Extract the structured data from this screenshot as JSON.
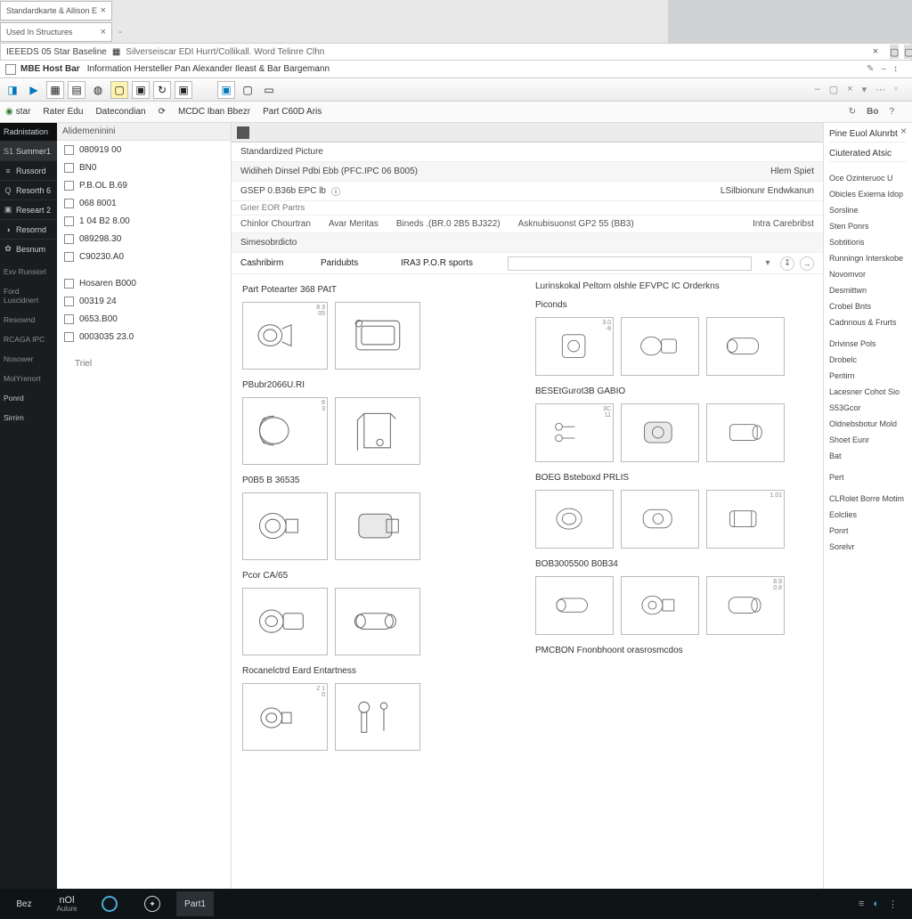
{
  "browser": {
    "tabs": [
      {
        "label": "Standardkarte & Allison Elements"
      },
      {
        "label": "Used In Structures"
      }
    ],
    "title_row1": "IEEEDS 05 Star Baseline",
    "title_row2_prefix": "MBE Host Bar",
    "title_row2": "Information  Hersteller Pan Alexander Ileast & Bar Bargemann"
  },
  "window": {
    "subtitle": "Silverseiscar EDI Hurrt/Collikall. Word Telinre Clhn"
  },
  "toolbar": {
    "labels": {
      "star": "star",
      "ratio": "Rater Edu",
      "desc": "Datecondian",
      "refresh": "",
      "midc": "MCDC Iban Bbezr",
      "part": "Part C60D Aris"
    }
  },
  "rail": {
    "header": "Radnistation",
    "items": [
      {
        "icon": "S1",
        "label": "Summer1",
        "selected": true
      },
      {
        "icon": "≡",
        "label": "Russord"
      },
      {
        "icon": "Q",
        "label": "Resorth 6"
      },
      {
        "icon": "▣",
        "label": "Researt 2"
      },
      {
        "icon": "◑",
        "label": "Resornd"
      },
      {
        "icon": "✿",
        "label": "Besnum"
      }
    ],
    "groups": [
      "Exv Runsiorl",
      "Ford Luscidnert",
      "Resownd",
      "RCAGA IPC",
      "Nosower",
      "MolYrenort"
    ],
    "sub_items": [
      "Ponrd",
      "Sirrirn"
    ]
  },
  "tree": {
    "header": "Alidemeninini",
    "rows": [
      "080919 00",
      "BN0",
      "P.B.OL B.69",
      "068 8001",
      "1 04 B2 8.00",
      "089298.30",
      "C90230.A0"
    ],
    "group2_label": "Hosaren B000",
    "group2_rows": [
      "00319 24",
      "0653.B00",
      "0003035 23.0"
    ],
    "footer_label": "Triel"
  },
  "content": {
    "topstrip_label": "Standardized Picture",
    "line1": "Widiheh Dinsel Pdbi Ebb (PFC.IPC 06 B005)",
    "line1_right": "Hlem Spiet",
    "line2_left": "GSEP 0.B36b EPC  lb",
    "line2_right": "LSilbionunr Endwkanun",
    "line3_left": "Grier EOR Partrs",
    "breadcrumbs": [
      "Chinlor  Chourtran",
      "Avar Meritas",
      "Bineds  .(BR.0 2B5 BJ322)",
      "Asknubisuonst GP2 55 (BB3)"
    ],
    "bc_right": "Intra Carebribst",
    "filter_section_label": "Simesobrdicto",
    "filter_cols": [
      "Cashribirm",
      "Paridubts",
      "IRA3 P.O.R sports"
    ],
    "gallery_header_left": "Part Potearter 368 PAtT",
    "gallery_header_right": "Lurinskokal Peltorn olshle EFVPC IC Orderkns",
    "gallery_header_right_sub": "Piconds",
    "left_col_categories": [
      "Part Potearter 368 PAtT",
      "PBubr2066U.RI",
      "P0B5 B 36535",
      "Pcor CA/65",
      "Rocanelctrd Eard Entartness"
    ],
    "right_col_categories": [
      "BESEtGurot3B GABIO",
      "BOEG Bsteboxd PRLIS",
      "BOB3005500 B0B34",
      "PMCBON Fnonbhoont orasrosmcdos"
    ]
  },
  "rpanel": {
    "headers": [
      "Pine Euol Alunrbt",
      "Ciuterated Atsic"
    ],
    "links": [
      "Oce Ozinteruoc U",
      "Obicles Exierna Idop",
      "Sorsline",
      "Sten Ponrs",
      "Sobtitioris",
      "Runningn Interskobe",
      "Novomvor",
      "Desmittwn",
      "Crobel Bnts",
      "Cadnnous & Frurts",
      "Drivinse Pols",
      "Drobelc",
      "Peritirn",
      "Lacesner Cohot Sio",
      "S53Gcor",
      "Oldnebsbotur Mold",
      "Shoet Eunr",
      "Bat",
      "Pert",
      "CLRolet Borre Motim",
      "Eolclies",
      "Ponrt",
      "Sorelvr"
    ]
  },
  "apprail": {
    "items": [
      {
        "label": "Bez"
      },
      {
        "label": "nOl",
        "sub": "Aulure"
      },
      {
        "icon": "globe"
      },
      {
        "icon": "mb"
      },
      {
        "label": "Part1",
        "selected": true
      }
    ]
  }
}
